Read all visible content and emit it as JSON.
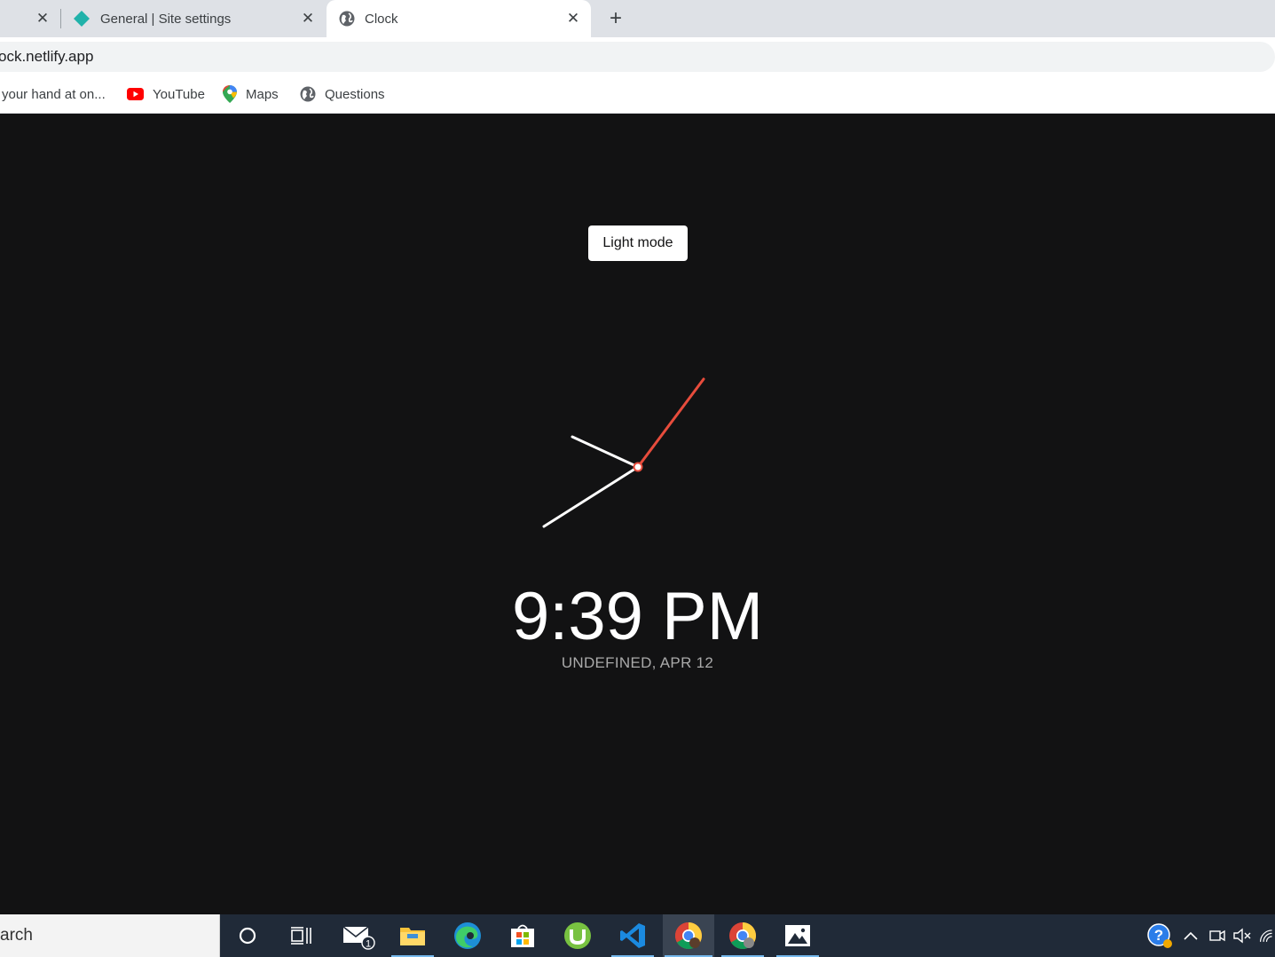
{
  "browser": {
    "tabs": [
      {
        "title": "",
        "favicon": "none",
        "active": false
      },
      {
        "title": "General | Site settings",
        "favicon": "netlify-diamond-icon",
        "active": false
      },
      {
        "title": "Clock",
        "favicon": "globe-icon",
        "active": true
      }
    ],
    "new_tab_icon": "+",
    "close_glyph": "✕",
    "address_bar": {
      "url": "ock.netlify.app"
    },
    "bookmarks": [
      {
        "label": "your hand at on...",
        "icon": "none"
      },
      {
        "label": "YouTube",
        "icon": "youtube-icon"
      },
      {
        "label": "Maps",
        "icon": "maps-pin-icon"
      },
      {
        "label": "Questions",
        "icon": "globe-icon"
      }
    ]
  },
  "page": {
    "toggle_label": "Light mode",
    "time": "9:39 PM",
    "date": "UNDEFINED, APR 12",
    "colors": {
      "background": "#121213",
      "hand": "#ffffff",
      "second_hand": "#e74c3c"
    }
  },
  "taskbar": {
    "search_text": "arch",
    "mail_badge": "1",
    "apps": [
      "cortana-icon",
      "task-view-icon",
      "mail-icon",
      "file-explorer-icon",
      "edge-icon",
      "store-icon",
      "utorrent-icon",
      "vscode-icon",
      "chrome-icon",
      "chrome-icon",
      "photos-icon"
    ]
  }
}
